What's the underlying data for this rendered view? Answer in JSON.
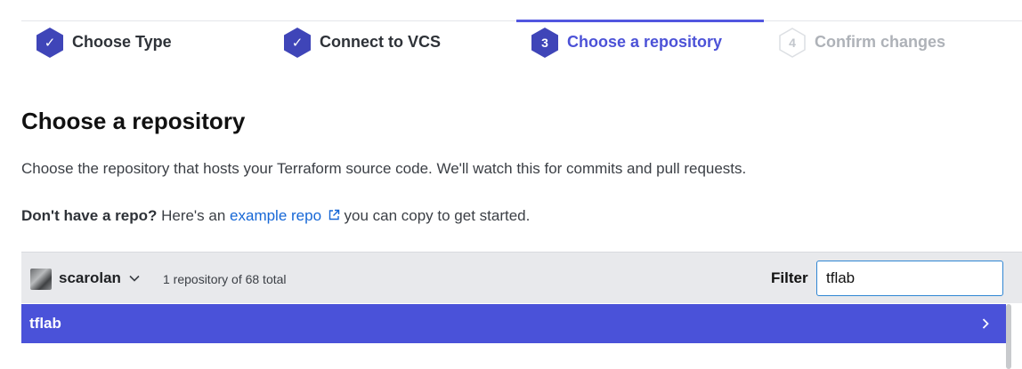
{
  "steps": [
    {
      "label": "Choose Type",
      "state": "done",
      "icon": "check-icon"
    },
    {
      "label": "Connect to VCS",
      "state": "done",
      "icon": "check-icon"
    },
    {
      "label": "Choose a repository",
      "state": "active",
      "number": "3"
    },
    {
      "label": "Confirm changes",
      "state": "disabled",
      "number": "4"
    }
  ],
  "heading": "Choose a repository",
  "description": "Choose the repository that hosts your Terraform source code. We'll watch this for commits and pull requests.",
  "hint": {
    "bold": "Don't have a repo?",
    "before_link": " Here's an ",
    "link": "example repo",
    "after_link": " you can copy to get started."
  },
  "toolbar": {
    "org": "scarolan",
    "count": "1 repository of 68 total",
    "filter_label": "Filter",
    "filter_value": "tflab"
  },
  "repos": [
    {
      "name": "tflab"
    }
  ],
  "colors": {
    "accent": "#4a52d9",
    "step_done": "#3f45b8",
    "link": "#1667d6"
  }
}
